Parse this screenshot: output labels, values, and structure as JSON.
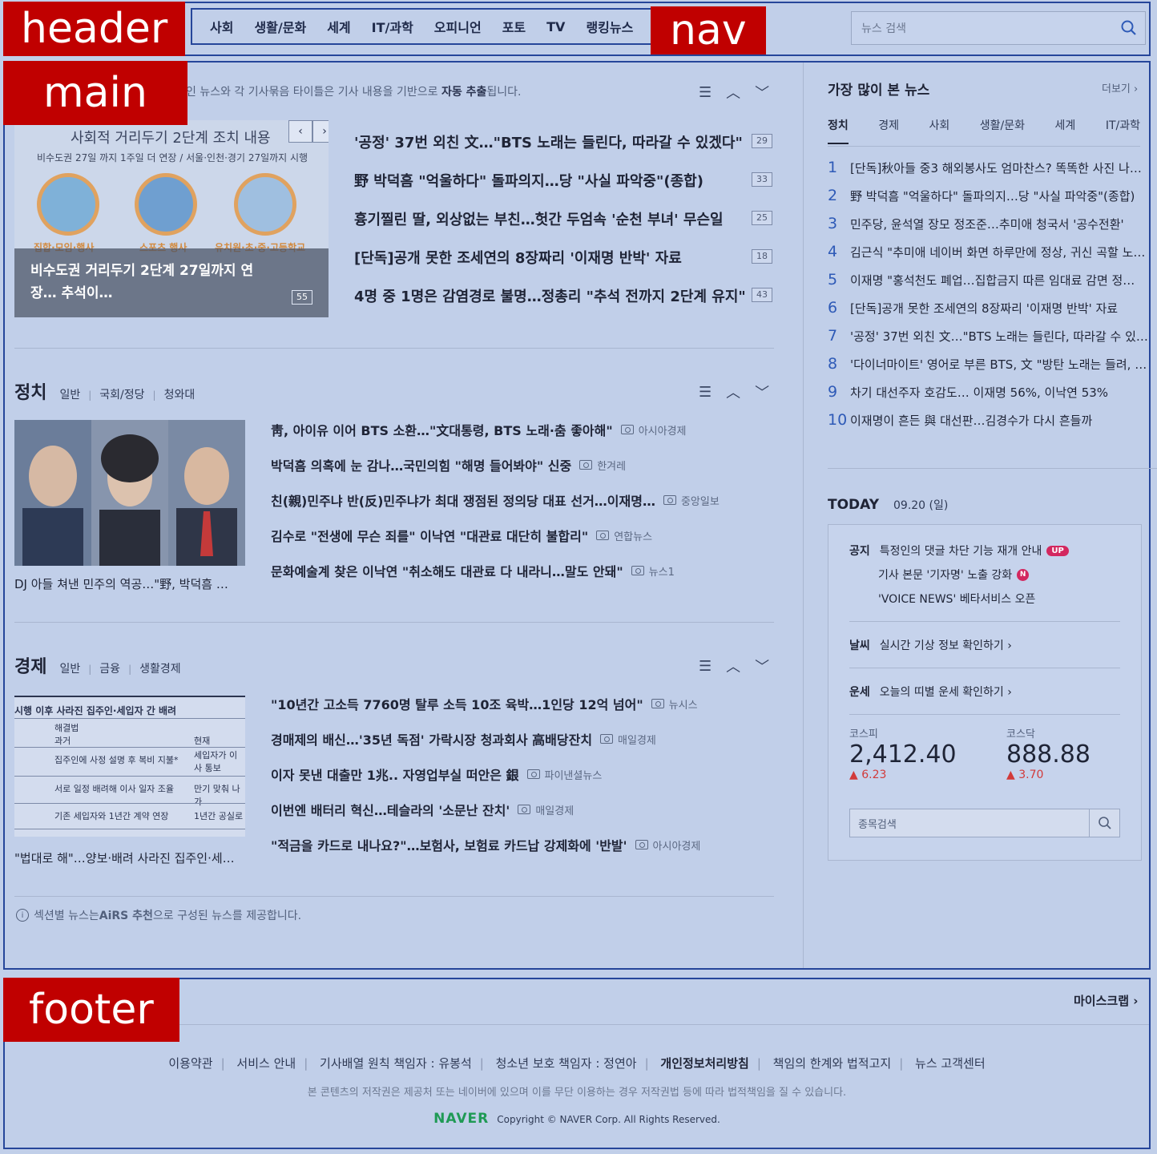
{
  "tags": {
    "header": "header",
    "nav": "nav",
    "main": "main",
    "footer": "footer"
  },
  "nav": {
    "items": [
      "사회",
      "생활/문화",
      "세계",
      "IT/과학",
      "오피니언",
      "포토",
      "TV",
      "랭킹뉴스"
    ]
  },
  "search": {
    "placeholder": "뉴스 검색"
  },
  "notice": {
    "text": "인 뉴스와 각 기사묶음 타이틀은 기사 내용을 기반으로 ",
    "bold": "자동 추출",
    "tail": "됩니다."
  },
  "featured": {
    "title": "사회적 거리두기 2단계 조치 내용",
    "subtitle": "비수도권 27일 까지 1주일 더 연장 / 서울·인천·경기 27일까지 시행",
    "labels": [
      "집합·모임·행사",
      "스포츠 행사",
      "유치원·초·중·고등학교"
    ],
    "overlay_title": "비수도권 거리두기 2단계 27일까지 연장… 추석이…",
    "count": "55"
  },
  "headlines": [
    {
      "title": "'공정' 37번 외친 文…\"BTS 노래는 들린다, 따라갈 수 있겠다\"",
      "count": "29"
    },
    {
      "title": "野 박덕흠 \"억울하다\" 돌파의지…당 \"사실 파악중\"(종합)",
      "count": "33"
    },
    {
      "title": "흉기찔린 딸, 외상없는 부친…헛간 두엄속 '순천 부녀' 무슨일",
      "count": "25"
    },
    {
      "title": "[단독]공개 못한 조세연의 8장짜리 '이재명 반박' 자료",
      "count": "18"
    },
    {
      "title": "4명 중 1명은 감염경로 불명…정총리 \"추석 전까지 2단계 유지\"",
      "count": "43"
    }
  ],
  "politics": {
    "title": "정치",
    "subs": [
      "일반",
      "국회/정당",
      "청와대"
    ],
    "caption": "DJ 아들 쳐낸 민주의 역공…\"野, 박덕흠 …",
    "articles": [
      {
        "title": "靑, 아이유 이어 BTS 소환…\"文대통령, BTS 노래·춤 좋아해\"",
        "source": "아시아경제"
      },
      {
        "title": "박덕흠 의혹에 눈 감나…국민의힘 \"해명 들어봐야\" 신중",
        "source": "한겨레"
      },
      {
        "title": "친(親)민주냐 반(反)민주냐가 최대 쟁점된 정의당 대표 선거…이재명…",
        "source": "중앙일보"
      },
      {
        "title": "김수로 \"전생에 무슨 죄를\" 이낙연 \"대관료 대단히 불합리\"",
        "source": "연합뉴스"
      },
      {
        "title": "문화예술계 찾은 이낙연 \"취소해도 대관료 다 내라니…말도 안돼\"",
        "source": "뉴스1"
      }
    ]
  },
  "economy": {
    "title": "경제",
    "subs": [
      "일반",
      "금융",
      "생활경제"
    ],
    "caption": "\"법대로 해\"…양보·배려 사라진 집주인·세…",
    "doc_title": "시행 이후 사라진 집주인·세입자 간 배려",
    "doc_rows": [
      "해결법",
      "과거",
      "현재",
      "집주인에 사정 설명 후 복비 지불*",
      "세입자가 이사 통보",
      "서로 일정 배려해 이사 일자 조율",
      "만기 맞춰 나가",
      "기존 세입자와 1년간 계약 연장",
      "1년간 공실로"
    ],
    "articles": [
      {
        "title": "\"10년간 고소득 7760명 탈루 소득 10조 육박…1인당 12억 넘어\"",
        "source": "뉴시스"
      },
      {
        "title": "경매제의 배신…'35년 독점' 가락시장 청과회사 高배당잔치",
        "source": "매일경제"
      },
      {
        "title": "이자 못낸 대출만 1兆.. 자영업부실 떠안은 銀",
        "source": "파이낸셜뉴스"
      },
      {
        "title": "이번엔 배터리 혁신…테슬라의 '소문난 잔치'",
        "source": "매일경제"
      },
      {
        "title": "\"적금을 카드로 내나요?\"…보험사, 보험료 카드납 강제화에 '반발'",
        "source": "아시아경제"
      }
    ]
  },
  "airs_note": {
    "pre": "섹션별 뉴스는 ",
    "bold": "AiRS 추천",
    "post": "으로 구성된 뉴스를 제공합니다."
  },
  "ranking": {
    "title": "가장 많이 본 뉴스",
    "more": "더보기 ›",
    "tabs": [
      "정치",
      "경제",
      "사회",
      "생활/문화",
      "세계",
      "IT/과학"
    ],
    "items": [
      {
        "n": "1",
        "t": "[단독]秋아들 중3 해외봉사도 엄마찬스? 똑똑한 사진 나…"
      },
      {
        "n": "2",
        "t": "野 박덕흠 \"억울하다\" 돌파의지…당 \"사실 파악중\"(종합)"
      },
      {
        "n": "3",
        "t": "민주당, 윤석열 장모 정조준…추미애 청국서 '공수전환'"
      },
      {
        "n": "4",
        "t": "김근식 \"추미애 네이버 화면 하루만에 정상, 귀신 곡할 노…"
      },
      {
        "n": "5",
        "t": "이재명 \"홍석천도 폐업…집합금지 따른 임대료 감면 정…"
      },
      {
        "n": "6",
        "t": "[단독]공개 못한 조세연의 8장짜리 '이재명 반박' 자료"
      },
      {
        "n": "7",
        "t": "'공정' 37번 외친 文…\"BTS 노래는 들린다, 따라갈 수 있…"
      },
      {
        "n": "8",
        "t": "'다이너마이트' 영어로 부른 BTS, 文 \"방탄 노래는 들려, …"
      },
      {
        "n": "9",
        "t": "차기 대선주자 호감도… 이재명 56%, 이낙연 53%"
      },
      {
        "n": "10",
        "t": "이재명이 흔든 與 대선판…김경수가 다시 흔들까"
      }
    ]
  },
  "today": {
    "title": "TODAY",
    "date": "09.20 (일)",
    "notice_label": "공지",
    "notices": [
      "특정인의 댓글 차단 기능 재개 안내",
      "기사 본문 '기자명' 노출 강화",
      "'VOICE NEWS' 베타서비스 오픈"
    ],
    "badge_up": "UP",
    "badge_n": "N",
    "weather_label": "날씨",
    "weather_text": "실시간 기상 정보 확인하기 ›",
    "fortune_label": "운세",
    "fortune_text": "오늘의 띠별 운세 확인하기 ›",
    "kospi": {
      "label": "코스피",
      "value": "2,412.40",
      "change": "▲ 6.23"
    },
    "kosdaq": {
      "label": "코스닥",
      "value": "888.88",
      "change": "▲ 3.70"
    },
    "stock_search": "종목검색"
  },
  "footer": {
    "more": "마이스크랩 ›",
    "links": [
      "이용약관",
      "서비스 안내",
      "기사배열 원칙 책임자 : 유봉석",
      "청소년 보호 책임자 : 정연아",
      "개인정보처리방침",
      "책임의 한계와 법적고지",
      "뉴스 고객센터"
    ],
    "copyright_notice": "본 콘텐츠의 저작권은 제공처 또는 네이버에 있으며 이를 무단 이용하는 경우 저작권법 등에 따라 법적책임을 질 수 있습니다.",
    "logo": "NAVER",
    "copyright": "Copyright © NAVER Corp. All Rights Reserved."
  },
  "colors": {
    "accent": "#2e5ab7",
    "tag": "#c00000",
    "overlay_border": "#26469a",
    "brand": "#1f9a55",
    "up": "#d23a3a"
  }
}
